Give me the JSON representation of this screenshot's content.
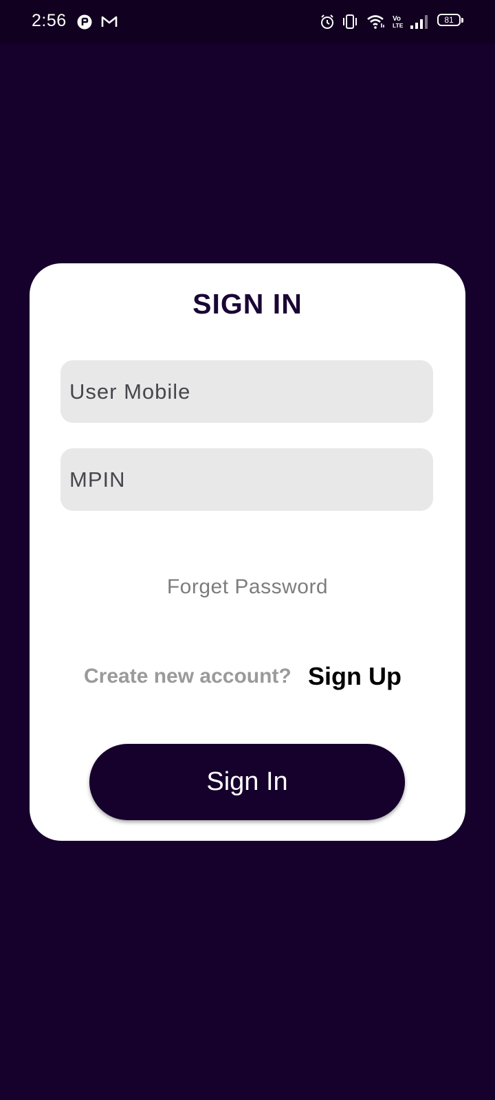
{
  "status_bar": {
    "time": "2:56",
    "left_icons": [
      "notification-app-icon",
      "gmail-icon"
    ],
    "right_icons": [
      "alarm-icon",
      "vibrate-icon",
      "wifi-icon",
      "volte-icon",
      "signal-icon"
    ],
    "volte_label": "Vo\nLTE",
    "battery_level": "81"
  },
  "colors": {
    "background": "#16002c",
    "card": "#ffffff",
    "field_background": "#e8e8e8",
    "button_background": "#16002c",
    "title_color": "#1a0535"
  },
  "login_card": {
    "title": "SIGN IN",
    "mobile_field": {
      "placeholder": "User Mobile",
      "value": ""
    },
    "mpin_field": {
      "placeholder": "MPIN",
      "value": ""
    },
    "forget_password": "Forget Password",
    "create_account_prompt": "Create new account?",
    "sign_up": "Sign Up",
    "sign_in_button": "Sign In"
  }
}
